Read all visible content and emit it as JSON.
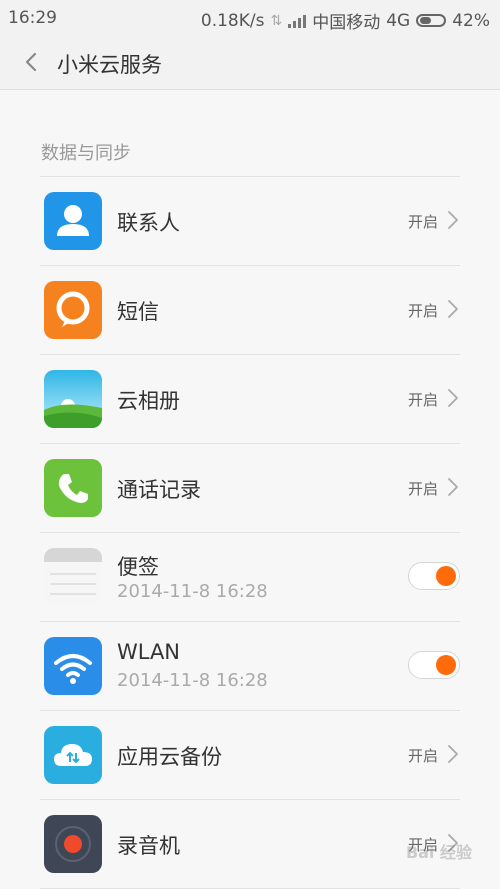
{
  "status": {
    "time": "16:29",
    "speed": "0.18K/s",
    "carrier": "中国移动",
    "network": "4G",
    "battery": "42%"
  },
  "header": {
    "title": "小米云服务"
  },
  "section": {
    "label": "数据与同步"
  },
  "items": [
    {
      "title": "联系人",
      "status": "开启",
      "control": "chevron",
      "icon": "contacts-icon",
      "color": "#2196e8"
    },
    {
      "title": "短信",
      "status": "开启",
      "control": "chevron",
      "icon": "message-icon",
      "color": "#f5821f"
    },
    {
      "title": "云相册",
      "status": "开启",
      "control": "chevron",
      "icon": "gallery-icon",
      "color": "#46c2e8"
    },
    {
      "title": "通话记录",
      "status": "开启",
      "control": "chevron",
      "icon": "phone-icon",
      "color": "#6cc33b"
    },
    {
      "title": "便签",
      "subtitle": "2014-11-8 16:28",
      "control": "toggle",
      "icon": "notes-icon",
      "color": "#e9e9e9"
    },
    {
      "title": "WLAN",
      "subtitle": "2014-11-8 16:28",
      "control": "toggle",
      "icon": "wifi-icon",
      "color": "#2a8ee8"
    },
    {
      "title": "应用云备份",
      "status": "开启",
      "control": "chevron",
      "icon": "cloud-backup-icon",
      "color": "#2aaee0"
    },
    {
      "title": "录音机",
      "status": "开启",
      "control": "chevron",
      "icon": "recorder-icon",
      "color": "#3f4656"
    }
  ],
  "watermark": "Bai 经验"
}
